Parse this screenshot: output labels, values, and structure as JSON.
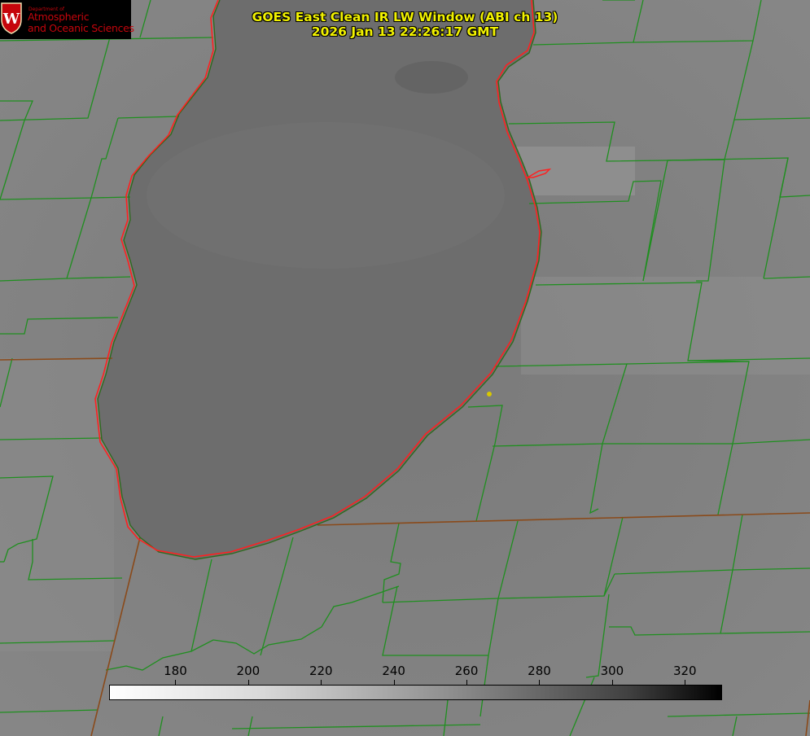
{
  "title": {
    "line1": "GOES East Clean IR LW Window (ABI ch 13)",
    "line2": "2026 Jan 13 22:26:17 GMT"
  },
  "logo": {
    "department": "Department of",
    "line1": "Atmospheric",
    "line2": "and Oceanic Sciences",
    "seal_letter": "W"
  },
  "colorbar": {
    "ticks": [
      "180",
      "200",
      "220",
      "240",
      "260",
      "280",
      "300",
      "320"
    ],
    "range": [
      162,
      330
    ],
    "colormap": "white-to-black"
  },
  "colors": {
    "county_lines": "#1f8f1f",
    "state_lines": "#8a4a1a",
    "coastline": "#ff2020",
    "station_marker": "#d8c800",
    "title_text": "#f2f200",
    "background": "#808080",
    "lake": "#6e6e6e"
  }
}
